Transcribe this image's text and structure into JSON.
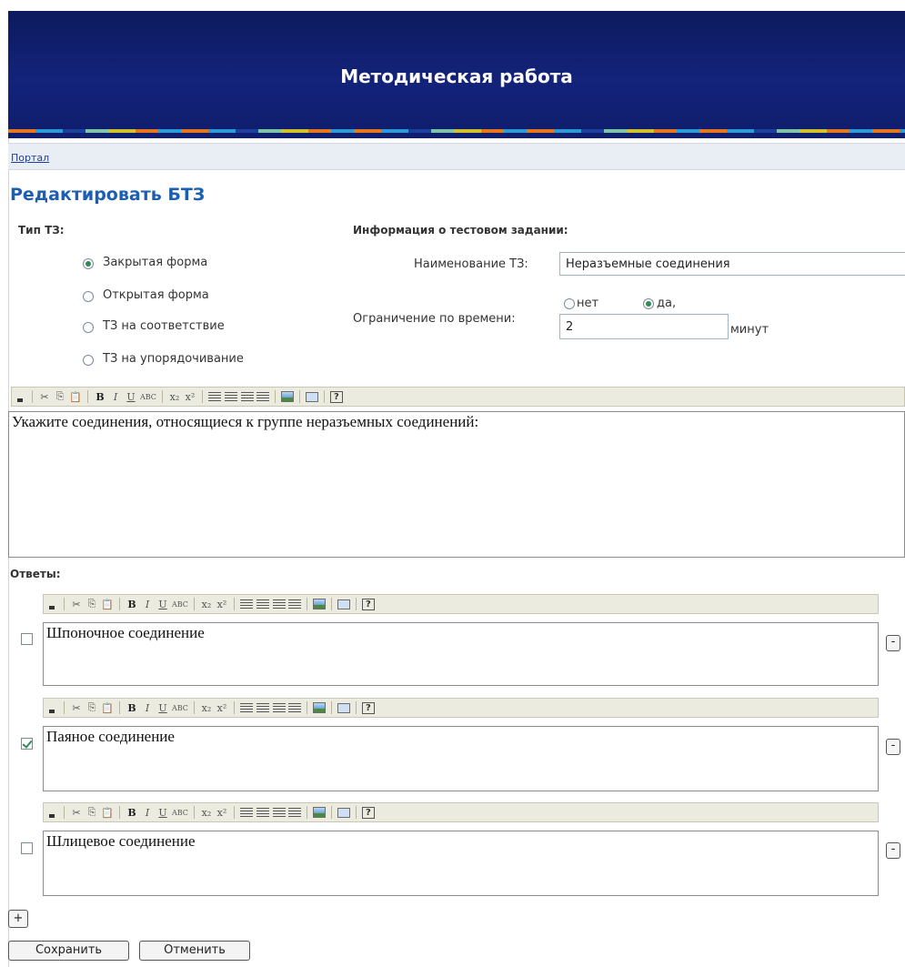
{
  "header": {
    "title": "Методическая работа"
  },
  "breadcrumb": {
    "portal": "Портал"
  },
  "page_title": "Редактировать БТЗ",
  "type_section": {
    "label": "Тип ТЗ:",
    "options": [
      {
        "label": "Закрытая форма",
        "selected": true
      },
      {
        "label": "Открытая форма",
        "selected": false
      },
      {
        "label": "ТЗ на соответствие",
        "selected": false
      },
      {
        "label": "ТЗ на упорядочивание",
        "selected": false
      }
    ]
  },
  "info_section": {
    "label": "Информация о тестовом задании:",
    "name_label": "Наименование ТЗ:",
    "name_value": "Неразъемные соединения",
    "time_label": "Ограничение по времени:",
    "time_no": "нет",
    "time_yes": "да,",
    "time_yes_selected": true,
    "time_value": "2",
    "time_unit": "минут"
  },
  "question_text": "Укажите соединения, относящиеся к группе неразъемных соединений:",
  "answers_label": "Ответы:",
  "answers": [
    {
      "text": "Шпоночное соединение",
      "checked": false
    },
    {
      "text": "Паяное соединение",
      "checked": true
    },
    {
      "text": "Шлицевое соединение",
      "checked": false
    }
  ],
  "buttons": {
    "add": "+",
    "remove": "-",
    "save": "Сохранить",
    "cancel": "Отменить"
  },
  "toolbar": {
    "cut": "✂",
    "copy": "⎘",
    "paste": "📋",
    "bold": "B",
    "italic": "I",
    "underline": "U",
    "strike": "ABC",
    "sub": "x₂",
    "sup": "x²",
    "help": "?"
  }
}
